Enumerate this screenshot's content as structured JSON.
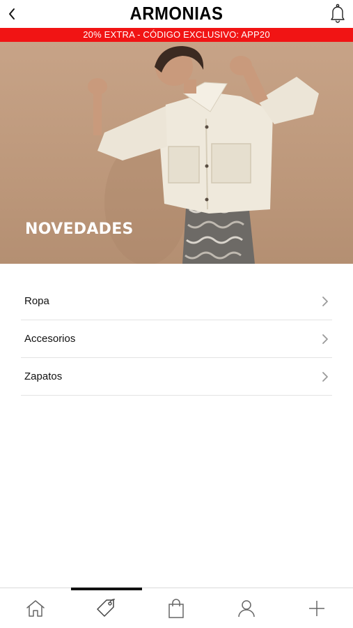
{
  "header": {
    "brand": "ARMONIAS",
    "back_icon": "chevron-left-icon",
    "notification_icon": "bell-icon"
  },
  "promo": {
    "text": "20% EXTRA - CÓDIGO EXCLUSIVO: APP20",
    "color": "#f11414"
  },
  "hero": {
    "title": "NOVEDADES"
  },
  "categories": [
    {
      "label": "Ropa"
    },
    {
      "label": "Accesorios"
    },
    {
      "label": "Zapatos"
    }
  ],
  "bottom_nav": {
    "active_index": 1,
    "items": [
      {
        "icon": "home-icon"
      },
      {
        "icon": "tag-icon"
      },
      {
        "icon": "shopping-bag-icon"
      },
      {
        "icon": "user-icon"
      },
      {
        "icon": "plus-icon"
      }
    ]
  }
}
